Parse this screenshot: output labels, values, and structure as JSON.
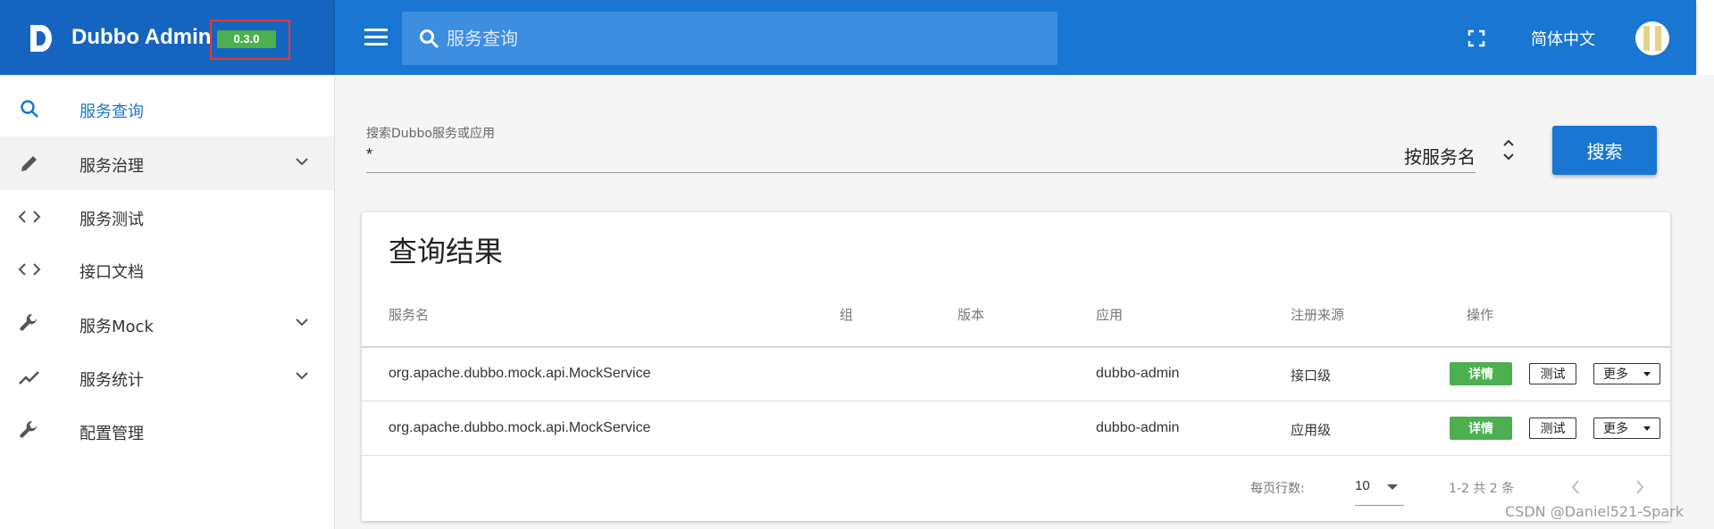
{
  "app": {
    "title": "Dubbo Admin",
    "version": "0.3.0",
    "language": "简体中文",
    "brand_color": "#1565c0",
    "appbar_color": "#1976d2"
  },
  "header_search": {
    "placeholder": "服务查询"
  },
  "sidebar": {
    "items": [
      {
        "label": "服务查询",
        "icon": "search-icon",
        "selected": true
      },
      {
        "label": "服务治理",
        "icon": "pencil-icon",
        "expandable": true
      },
      {
        "label": "服务测试",
        "icon": "code-icon"
      },
      {
        "label": "接口文档",
        "icon": "code-icon"
      },
      {
        "label": "服务Mock",
        "icon": "wrench-icon",
        "expandable": true
      },
      {
        "label": "服务统计",
        "icon": "trending-icon",
        "expandable": true
      },
      {
        "label": "配置管理",
        "icon": "wrench-icon"
      }
    ]
  },
  "search_form": {
    "label": "搜索Dubbo服务或应用",
    "value": "*",
    "type_select": "按服务名",
    "search_button": "搜索"
  },
  "results": {
    "title": "查询结果",
    "columns": [
      "服务名",
      "组",
      "版本",
      "应用",
      "注册来源",
      "操作"
    ],
    "rows": [
      {
        "service": "org.apache.dubbo.mock.api.MockService",
        "group": "",
        "version": "",
        "application": "dubbo-admin",
        "source": "接口级"
      },
      {
        "service": "org.apache.dubbo.mock.api.MockService",
        "group": "",
        "version": "",
        "application": "dubbo-admin",
        "source": "应用级"
      }
    ],
    "actions": {
      "detail": "详情",
      "test": "测试",
      "more": "更多"
    },
    "pagination": {
      "rows_per_page_label": "每页行数:",
      "rows_per_page": "10",
      "range": "1-2 共 2 条"
    }
  },
  "watermark": "CSDN @Daniel521-Spark"
}
